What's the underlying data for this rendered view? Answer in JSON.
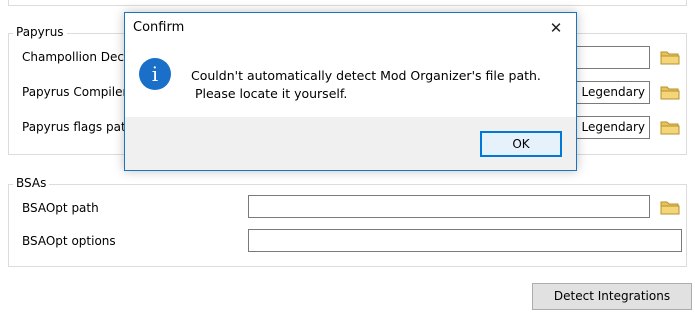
{
  "top_strip": {},
  "papyrus": {
    "title": "Papyrus",
    "rows": [
      {
        "label": "Champollion Deco",
        "value": ""
      },
      {
        "label": "Papyrus Compiler",
        "value": "n Legendary"
      },
      {
        "label": "Papyrus flags pat",
        "value": "n Legendary"
      }
    ]
  },
  "bsas": {
    "title": "BSAs",
    "rows": [
      {
        "label": "BSAOpt path",
        "value": ""
      },
      {
        "label": "BSAOpt options",
        "value": ""
      }
    ]
  },
  "detect_button": "Detect Integrations",
  "dialog": {
    "title": "Confirm",
    "message_line1": "Couldn't automatically detect Mod Organizer's file path.",
    "message_line2": " Please locate it yourself.",
    "ok_label": "OK",
    "close_glyph": "✕",
    "info_glyph": "i"
  },
  "icons": {
    "folder": "folder-icon",
    "info": "info-icon",
    "close": "close-icon"
  },
  "colors": {
    "accent": "#1e73be",
    "info_blue": "#1a6fc9",
    "button_face": "#e1e1e1",
    "folder_yellow": "#e8c25a"
  }
}
